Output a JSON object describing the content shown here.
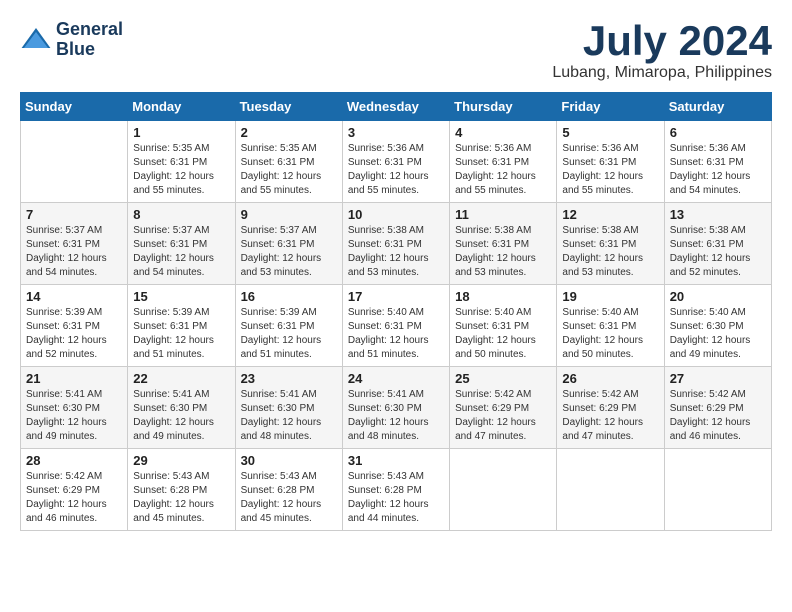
{
  "header": {
    "logo_line1": "General",
    "logo_line2": "Blue",
    "month_title": "July 2024",
    "location": "Lubang, Mimaropa, Philippines"
  },
  "calendar": {
    "days_of_week": [
      "Sunday",
      "Monday",
      "Tuesday",
      "Wednesday",
      "Thursday",
      "Friday",
      "Saturday"
    ],
    "weeks": [
      [
        {
          "day": "",
          "detail": ""
        },
        {
          "day": "1",
          "detail": "Sunrise: 5:35 AM\nSunset: 6:31 PM\nDaylight: 12 hours\nand 55 minutes."
        },
        {
          "day": "2",
          "detail": "Sunrise: 5:35 AM\nSunset: 6:31 PM\nDaylight: 12 hours\nand 55 minutes."
        },
        {
          "day": "3",
          "detail": "Sunrise: 5:36 AM\nSunset: 6:31 PM\nDaylight: 12 hours\nand 55 minutes."
        },
        {
          "day": "4",
          "detail": "Sunrise: 5:36 AM\nSunset: 6:31 PM\nDaylight: 12 hours\nand 55 minutes."
        },
        {
          "day": "5",
          "detail": "Sunrise: 5:36 AM\nSunset: 6:31 PM\nDaylight: 12 hours\nand 55 minutes."
        },
        {
          "day": "6",
          "detail": "Sunrise: 5:36 AM\nSunset: 6:31 PM\nDaylight: 12 hours\nand 54 minutes."
        }
      ],
      [
        {
          "day": "7",
          "detail": "Sunrise: 5:37 AM\nSunset: 6:31 PM\nDaylight: 12 hours\nand 54 minutes."
        },
        {
          "day": "8",
          "detail": "Sunrise: 5:37 AM\nSunset: 6:31 PM\nDaylight: 12 hours\nand 54 minutes."
        },
        {
          "day": "9",
          "detail": "Sunrise: 5:37 AM\nSunset: 6:31 PM\nDaylight: 12 hours\nand 53 minutes."
        },
        {
          "day": "10",
          "detail": "Sunrise: 5:38 AM\nSunset: 6:31 PM\nDaylight: 12 hours\nand 53 minutes."
        },
        {
          "day": "11",
          "detail": "Sunrise: 5:38 AM\nSunset: 6:31 PM\nDaylight: 12 hours\nand 53 minutes."
        },
        {
          "day": "12",
          "detail": "Sunrise: 5:38 AM\nSunset: 6:31 PM\nDaylight: 12 hours\nand 53 minutes."
        },
        {
          "day": "13",
          "detail": "Sunrise: 5:38 AM\nSunset: 6:31 PM\nDaylight: 12 hours\nand 52 minutes."
        }
      ],
      [
        {
          "day": "14",
          "detail": "Sunrise: 5:39 AM\nSunset: 6:31 PM\nDaylight: 12 hours\nand 52 minutes."
        },
        {
          "day": "15",
          "detail": "Sunrise: 5:39 AM\nSunset: 6:31 PM\nDaylight: 12 hours\nand 51 minutes."
        },
        {
          "day": "16",
          "detail": "Sunrise: 5:39 AM\nSunset: 6:31 PM\nDaylight: 12 hours\nand 51 minutes."
        },
        {
          "day": "17",
          "detail": "Sunrise: 5:40 AM\nSunset: 6:31 PM\nDaylight: 12 hours\nand 51 minutes."
        },
        {
          "day": "18",
          "detail": "Sunrise: 5:40 AM\nSunset: 6:31 PM\nDaylight: 12 hours\nand 50 minutes."
        },
        {
          "day": "19",
          "detail": "Sunrise: 5:40 AM\nSunset: 6:31 PM\nDaylight: 12 hours\nand 50 minutes."
        },
        {
          "day": "20",
          "detail": "Sunrise: 5:40 AM\nSunset: 6:30 PM\nDaylight: 12 hours\nand 49 minutes."
        }
      ],
      [
        {
          "day": "21",
          "detail": "Sunrise: 5:41 AM\nSunset: 6:30 PM\nDaylight: 12 hours\nand 49 minutes."
        },
        {
          "day": "22",
          "detail": "Sunrise: 5:41 AM\nSunset: 6:30 PM\nDaylight: 12 hours\nand 49 minutes."
        },
        {
          "day": "23",
          "detail": "Sunrise: 5:41 AM\nSunset: 6:30 PM\nDaylight: 12 hours\nand 48 minutes."
        },
        {
          "day": "24",
          "detail": "Sunrise: 5:41 AM\nSunset: 6:30 PM\nDaylight: 12 hours\nand 48 minutes."
        },
        {
          "day": "25",
          "detail": "Sunrise: 5:42 AM\nSunset: 6:29 PM\nDaylight: 12 hours\nand 47 minutes."
        },
        {
          "day": "26",
          "detail": "Sunrise: 5:42 AM\nSunset: 6:29 PM\nDaylight: 12 hours\nand 47 minutes."
        },
        {
          "day": "27",
          "detail": "Sunrise: 5:42 AM\nSunset: 6:29 PM\nDaylight: 12 hours\nand 46 minutes."
        }
      ],
      [
        {
          "day": "28",
          "detail": "Sunrise: 5:42 AM\nSunset: 6:29 PM\nDaylight: 12 hours\nand 46 minutes."
        },
        {
          "day": "29",
          "detail": "Sunrise: 5:43 AM\nSunset: 6:28 PM\nDaylight: 12 hours\nand 45 minutes."
        },
        {
          "day": "30",
          "detail": "Sunrise: 5:43 AM\nSunset: 6:28 PM\nDaylight: 12 hours\nand 45 minutes."
        },
        {
          "day": "31",
          "detail": "Sunrise: 5:43 AM\nSunset: 6:28 PM\nDaylight: 12 hours\nand 44 minutes."
        },
        {
          "day": "",
          "detail": ""
        },
        {
          "day": "",
          "detail": ""
        },
        {
          "day": "",
          "detail": ""
        }
      ]
    ]
  }
}
